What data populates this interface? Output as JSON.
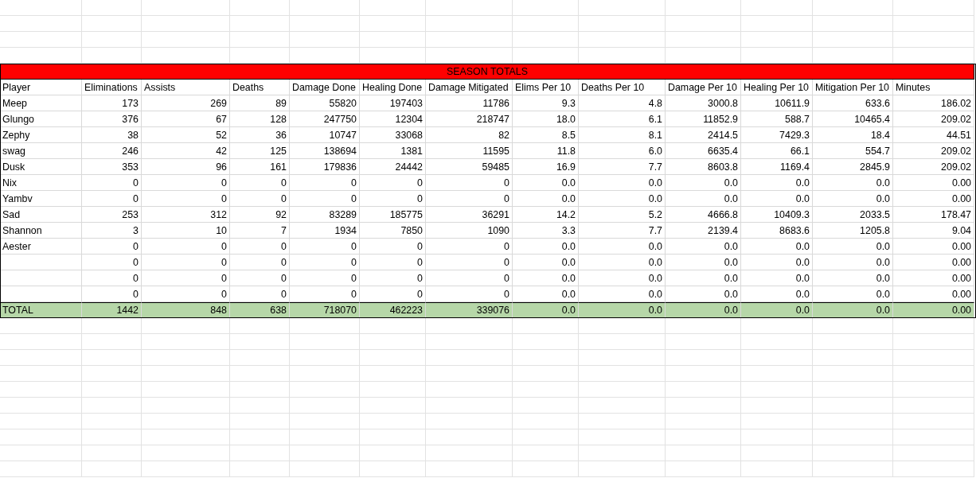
{
  "sheet": {
    "title": "SEASON TOTALS",
    "columns": [
      "Player",
      "Eliminations",
      "Assists",
      "Deaths",
      "Damage Done",
      "Healing Done",
      "Damage Mitigated",
      "Elims Per 10",
      "Deaths Per 10",
      "Damage Per 10",
      "Healing Per 10",
      "Mitigation Per 10",
      "Minutes"
    ],
    "rows": [
      {
        "player": "Meep",
        "values": [
          "173",
          "269",
          "89",
          "55820",
          "197403",
          "11786",
          "9.3",
          "4.8",
          "3000.8",
          "10611.9",
          "633.6",
          "186.02"
        ]
      },
      {
        "player": "Glungo",
        "values": [
          "376",
          "67",
          "128",
          "247750",
          "12304",
          "218747",
          "18.0",
          "6.1",
          "11852.9",
          "588.7",
          "10465.4",
          "209.02"
        ]
      },
      {
        "player": "Zephy",
        "values": [
          "38",
          "52",
          "36",
          "10747",
          "33068",
          "82",
          "8.5",
          "8.1",
          "2414.5",
          "7429.3",
          "18.4",
          "44.51"
        ]
      },
      {
        "player": "swag",
        "values": [
          "246",
          "42",
          "125",
          "138694",
          "1381",
          "11595",
          "11.8",
          "6.0",
          "6635.4",
          "66.1",
          "554.7",
          "209.02"
        ]
      },
      {
        "player": "Dusk",
        "values": [
          "353",
          "96",
          "161",
          "179836",
          "24442",
          "59485",
          "16.9",
          "7.7",
          "8603.8",
          "1169.4",
          "2845.9",
          "209.02"
        ]
      },
      {
        "player": "Nix",
        "values": [
          "0",
          "0",
          "0",
          "0",
          "0",
          "0",
          "0.0",
          "0.0",
          "0.0",
          "0.0",
          "0.0",
          "0.00"
        ]
      },
      {
        "player": "Yambv",
        "values": [
          "0",
          "0",
          "0",
          "0",
          "0",
          "0",
          "0.0",
          "0.0",
          "0.0",
          "0.0",
          "0.0",
          "0.00"
        ]
      },
      {
        "player": "Sad",
        "values": [
          "253",
          "312",
          "92",
          "83289",
          "185775",
          "36291",
          "14.2",
          "5.2",
          "4666.8",
          "10409.3",
          "2033.5",
          "178.47"
        ]
      },
      {
        "player": "Shannon",
        "values": [
          "3",
          "10",
          "7",
          "1934",
          "7850",
          "1090",
          "3.3",
          "7.7",
          "2139.4",
          "8683.6",
          "1205.8",
          "9.04"
        ]
      },
      {
        "player": "Aester",
        "values": [
          "0",
          "0",
          "0",
          "0",
          "0",
          "0",
          "0.0",
          "0.0",
          "0.0",
          "0.0",
          "0.0",
          "0.00"
        ]
      },
      {
        "values": [
          "0",
          "0",
          "0",
          "0",
          "0",
          "0",
          "0.0",
          "0.0",
          "0.0",
          "0.0",
          "0.0",
          "0.00"
        ]
      },
      {
        "values": [
          "0",
          "0",
          "0",
          "0",
          "0",
          "0",
          "0.0",
          "0.0",
          "0.0",
          "0.0",
          "0.0",
          "0.00"
        ]
      },
      {
        "values": [
          "0",
          "0",
          "0",
          "0",
          "0",
          "0",
          "0.0",
          "0.0",
          "0.0",
          "0.0",
          "0.0",
          "0.00"
        ]
      }
    ],
    "total": {
      "label": "TOTAL",
      "values": [
        "1442",
        "848",
        "638",
        "718070",
        "462223",
        "339076",
        "0.0",
        "0.0",
        "0.0",
        "0.0",
        "0.0",
        "0.00"
      ]
    }
  }
}
